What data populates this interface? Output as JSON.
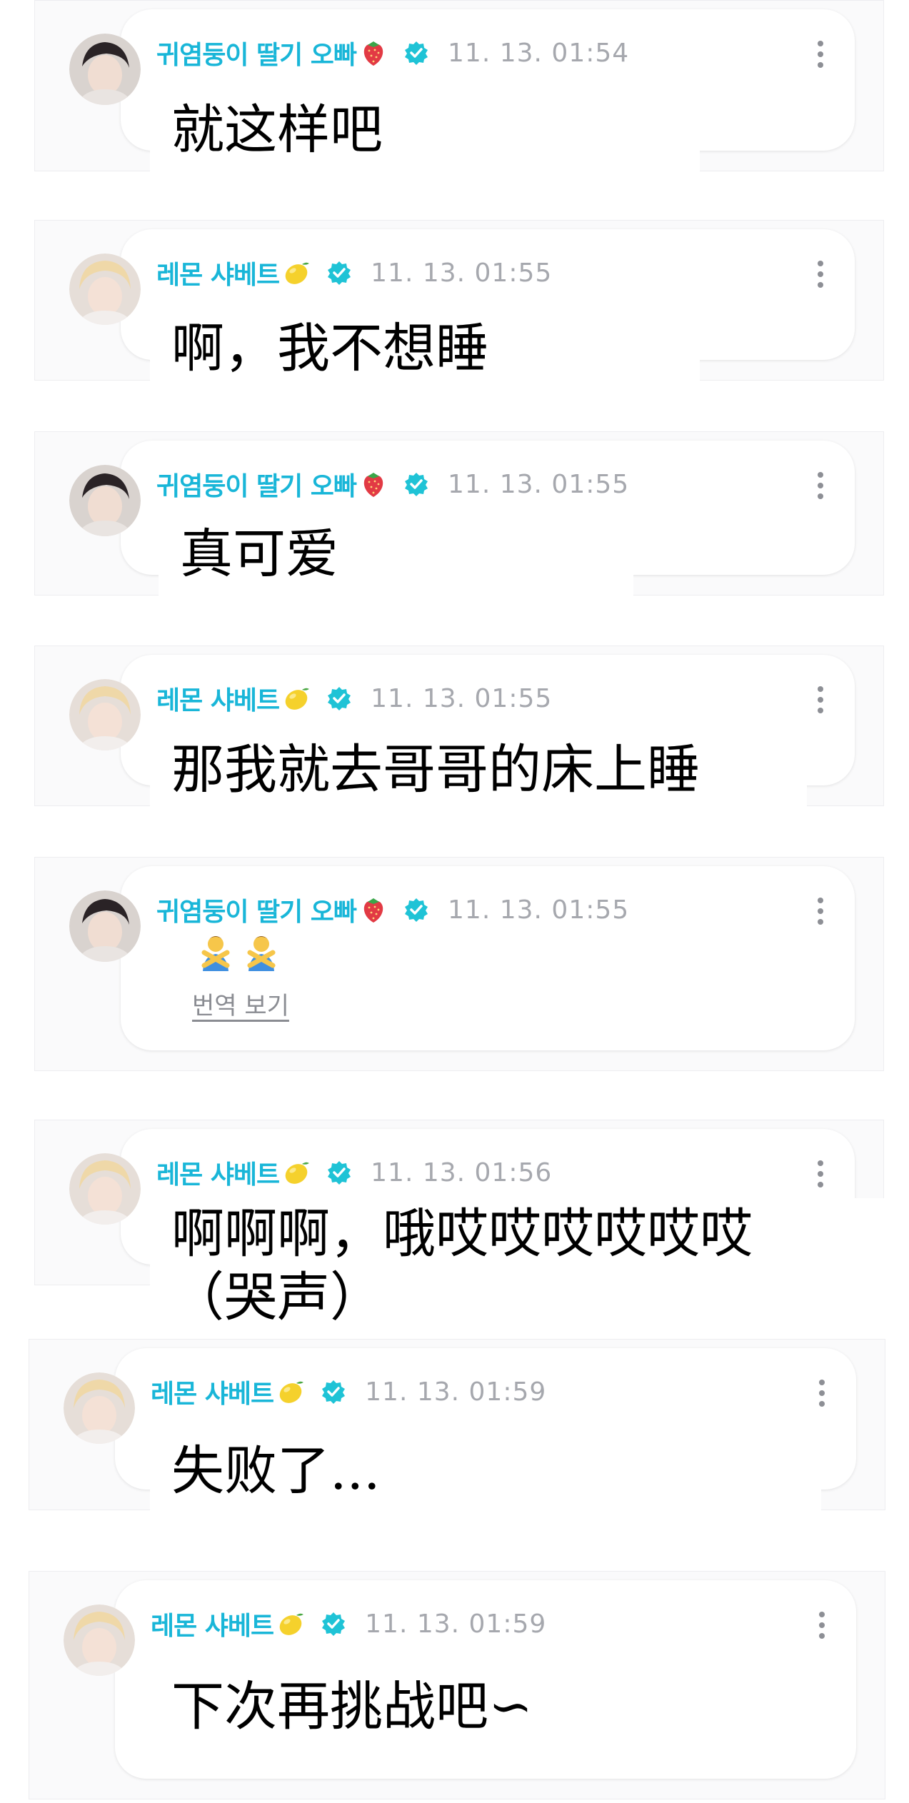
{
  "users": {
    "strawberry": {
      "name": "귀염둥이 딸기 오빠",
      "badge_emoji": "strawberry-icon"
    },
    "lemon": {
      "name": "레몬 샤베트",
      "badge_emoji": "lemon-icon"
    }
  },
  "comments": [
    {
      "user": "귀염둥이 딸기 오빠",
      "time": "11. 13. 01:54",
      "message": "就这样吧"
    },
    {
      "user": "레몬 샤베트",
      "time": "11. 13. 01:55",
      "message": "啊，我不想睡"
    },
    {
      "user": "귀염둥이 딸기 오빠",
      "time": "11. 13. 01:55",
      "message": "真可爱"
    },
    {
      "user": "레몬 샤베트",
      "time": "11. 13. 01:55",
      "message": "那我就去哥哥的床上睡"
    },
    {
      "user": "귀염둥이 딸기 오빠",
      "time": "11. 13. 01:55",
      "message_emojis": [
        "person-gesturing-no-icon",
        "person-gesturing-no-icon"
      ],
      "translate_label": "번역 보기"
    },
    {
      "user": "레몬 샤베트",
      "time": "11. 13. 01:56",
      "message": "啊啊啊，哦哎哎哎哎哎哎\n（哭声）"
    },
    {
      "user": "레몬 샤베트",
      "time": "11. 13. 01:59",
      "message": "失败了..."
    },
    {
      "user": "레몬 샤베트",
      "time": "11. 13. 01:59",
      "message": "下次再挑战吧∽"
    }
  ],
  "colors": {
    "username": "#19b6d8",
    "verified": "#1fc3d6",
    "timestamp": "#a6a8ae",
    "card_background": "#fafafb",
    "bubble_background": "#ffffff"
  }
}
